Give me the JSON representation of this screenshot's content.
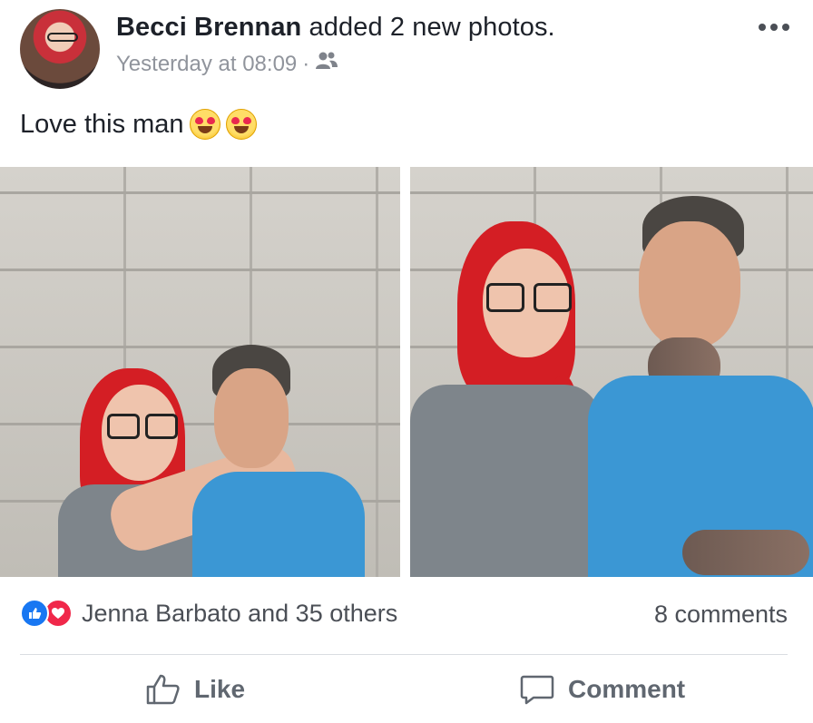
{
  "post": {
    "author": "Becci Brennan",
    "action": "added 2 new photos.",
    "timestamp": "Yesterday at 08:09",
    "separator": "·",
    "audience_icon": "friends-icon",
    "more_icon": "ellipsis-icon",
    "text": "Love this man",
    "emojis": [
      "heart-eyes-emoji",
      "heart-eyes-emoji"
    ]
  },
  "photos": [
    {
      "name": "photo-1"
    },
    {
      "name": "photo-2"
    }
  ],
  "footer": {
    "reaction_icons": [
      "like-reaction-icon",
      "love-reaction-icon"
    ],
    "reactors": "Jenna Barbato and 35 others",
    "comments": "8 comments",
    "like_label": "Like",
    "comment_label": "Comment"
  },
  "colors": {
    "like_blue": "#1877f2",
    "love_red": "#f0284a",
    "meta_gray": "#90949c",
    "action_gray": "#606770"
  }
}
